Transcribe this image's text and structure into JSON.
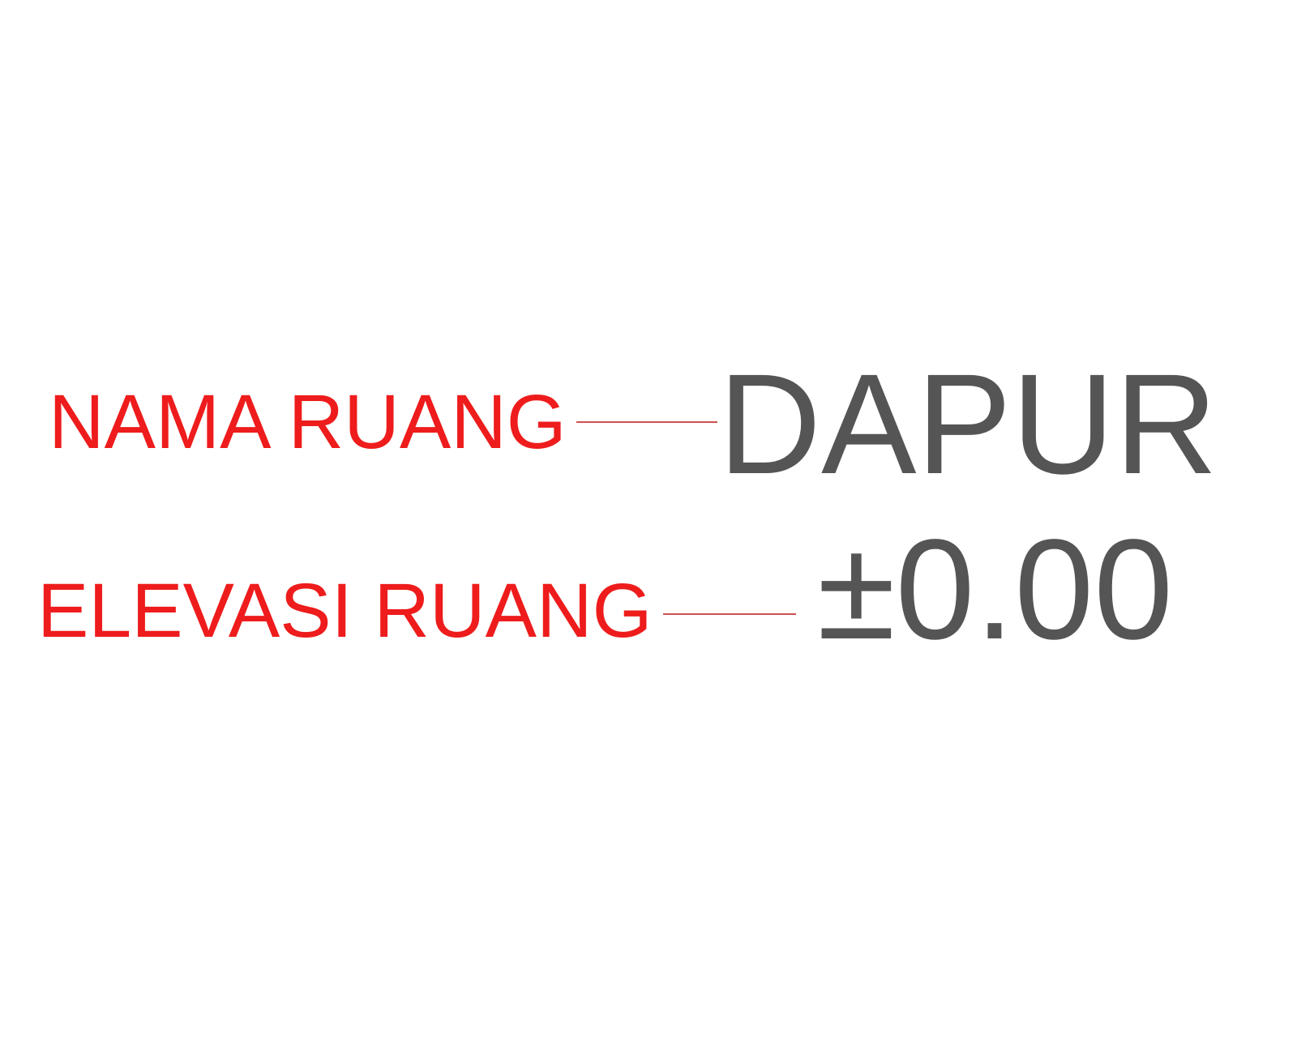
{
  "tag": {
    "name_label": "NAMA RUANG",
    "name_value": "DAPUR",
    "elevation_label": "ELEVASI RUANG",
    "elevation_value": "±0.00"
  },
  "colors": {
    "label": "#ee1c1c",
    "value": "#555555",
    "leader_line": "#d05050",
    "background": "#ffffff"
  }
}
